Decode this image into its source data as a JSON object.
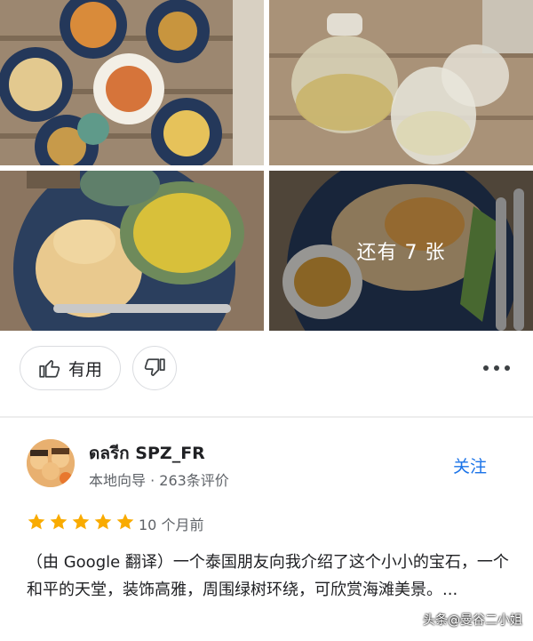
{
  "photos": {
    "more_label": "还有 7 张"
  },
  "actions": {
    "like_label": "有用"
  },
  "reviewer": {
    "name": "ดลรีก SPZ_FR",
    "meta": "本地向导 · 263条评价",
    "follow_label": "关注"
  },
  "review": {
    "rating": 5,
    "time": "10 个月前",
    "text": "（由 Google 翻译）一个泰国朋友向我介绍了这个小小的宝石，一个和平的天堂，装饰高雅，周围绿树环绕，可欣赏海滩美景。..."
  },
  "watermark": "头条@曼谷二小姐",
  "colors": {
    "accent": "#1a73e8",
    "star": "#f9ab00"
  }
}
